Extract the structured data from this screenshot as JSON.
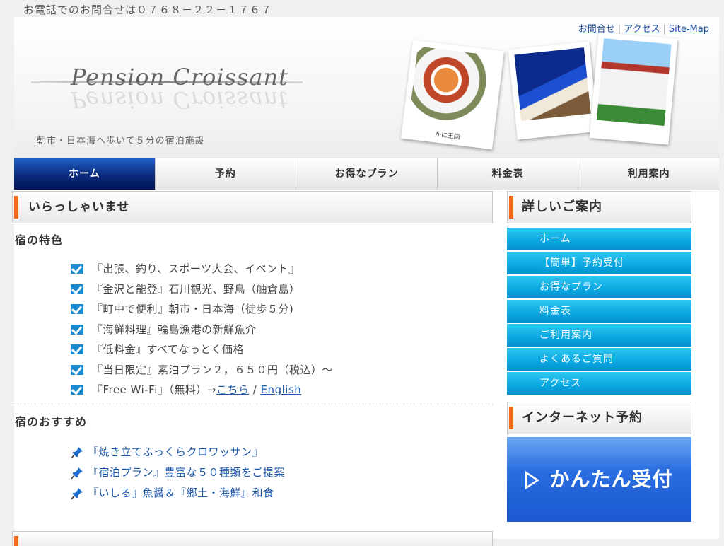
{
  "top_notice": "お電話でのお問合せは０７６８－２２－１７６７",
  "header": {
    "links": [
      "お問合せ",
      "アクセス",
      "Site-Map"
    ],
    "logo": "Pension Croissant",
    "tagline": "朝市・日本海へ歩いて５分の宿泊施設",
    "photo_captions": [
      "かに王国",
      "",
      ""
    ]
  },
  "nav": [
    "ホーム",
    "予約",
    "お得なプラン",
    "料金表",
    "利用案内"
  ],
  "main": {
    "welcome_title": "いらっしゃいませ",
    "features_title": "宿の特色",
    "features": [
      "『出張、釣り、スポーツ大会、イベント』",
      "『金沢と能登』石川観光、野鳥（舳倉島）",
      "『町中で便利』朝市・日本海（徒歩５分)",
      "『海鮮料理』輪島漁港の新鮮魚介",
      "『低料金』すべてなっとく価格",
      "『当日限定』素泊プラン２，６５０円（税込）～"
    ],
    "wifi_text": "『Free Wi-Fi』（無料）→",
    "wifi_link_ja": "こちら",
    "wifi_sep": " / ",
    "wifi_link_en": "English",
    "recommend_title": "宿のおすすめ",
    "recommends": [
      "『焼き立てふっくらクロワッサン』",
      "『宿泊プラン』豊富な５０種類をご提案",
      "『いしる』魚醤＆『郷土・海鮮』和食"
    ]
  },
  "side": {
    "guide_title": "詳しいご案内",
    "menu": [
      "ホーム",
      "【簡単】予約受付",
      "お得なプラン",
      "料金表",
      "ご利用案内",
      "よくあるご質問",
      "アクセス"
    ],
    "booking_title": "インターネット予約",
    "booking_button": "かんたん受付"
  },
  "colors": {
    "nav_active": "#0a2c7e",
    "side_menu": "#0aa6e0",
    "accent": "#f06b1a",
    "link": "#1a55a8"
  }
}
